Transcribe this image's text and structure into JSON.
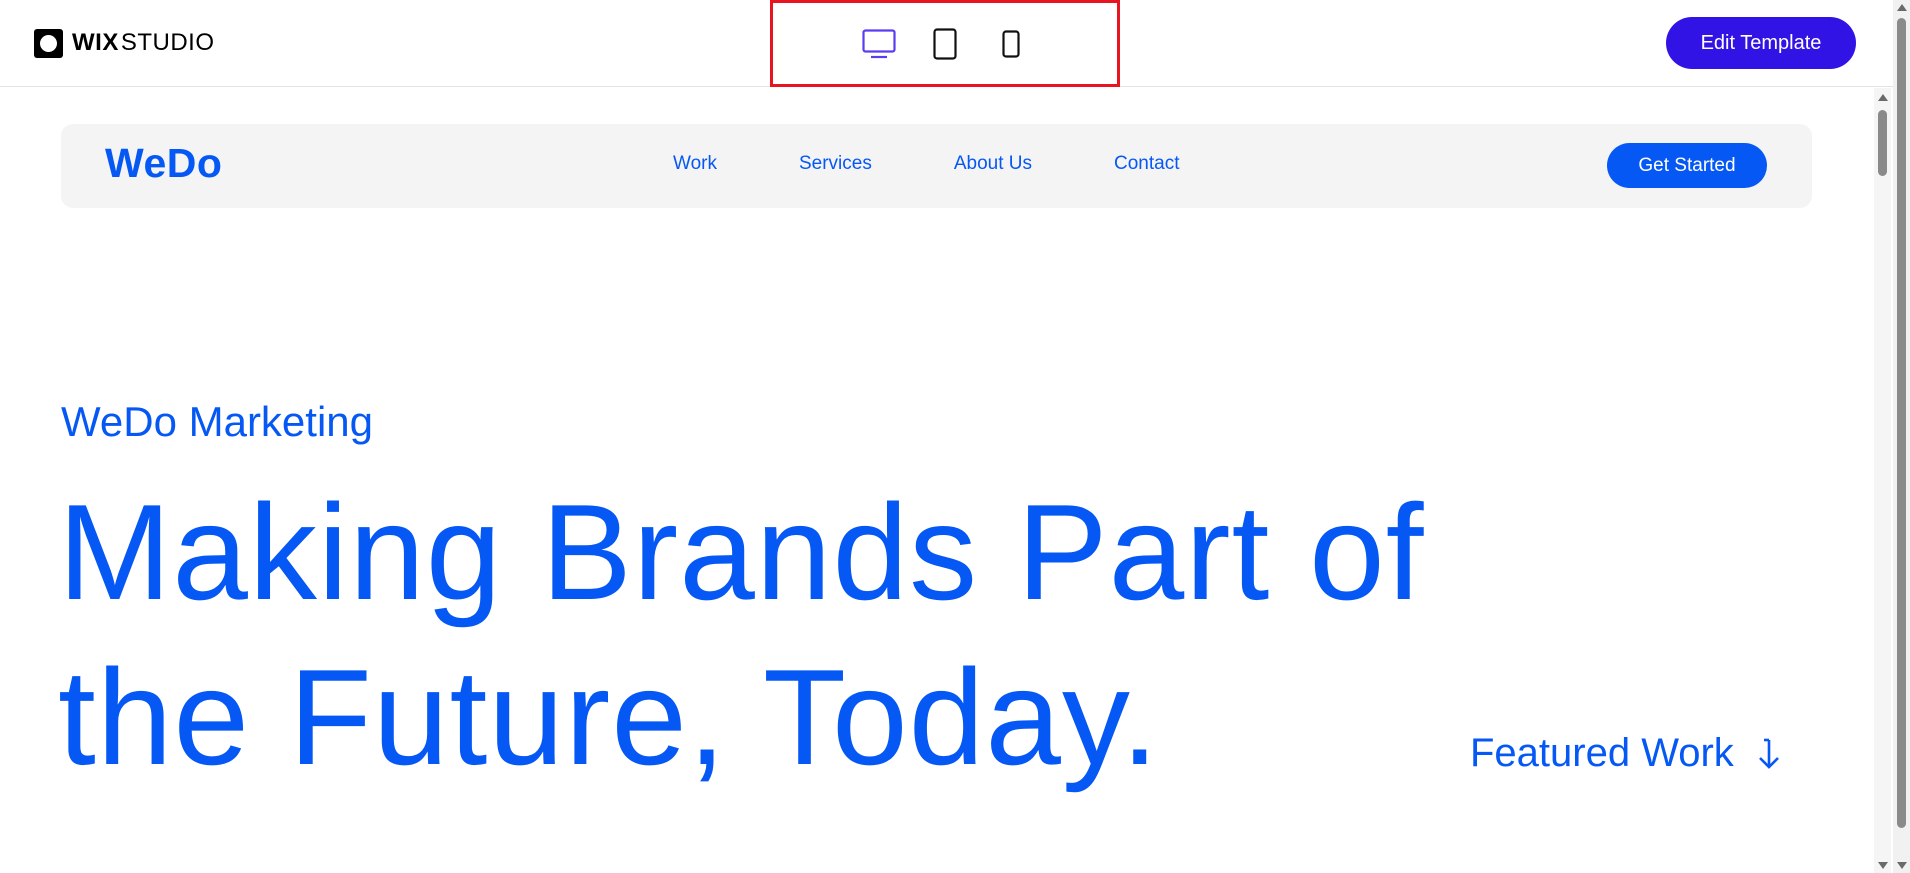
{
  "topbar": {
    "logo_bold": "WIX",
    "logo_light": "STUDIO",
    "devices": [
      {
        "name": "desktop",
        "icon": "desktop-icon",
        "active": true
      },
      {
        "name": "tablet",
        "icon": "tablet-icon",
        "active": false
      },
      {
        "name": "mobile",
        "icon": "mobile-icon",
        "active": false
      }
    ],
    "edit_button_label": "Edit Template"
  },
  "site": {
    "logo": "WeDo",
    "nav": [
      "Work",
      "Services",
      "About Us",
      "Contact"
    ],
    "cta_label": "Get Started",
    "hero": {
      "subtitle": "WeDo Marketing",
      "title_line1": "Making Brands Part of",
      "title_line2": "the Future, Today."
    },
    "featured_label": "Featured Work",
    "featured_icon": "arrow-down-icon"
  },
  "colors": {
    "brand_blue": "#0658f5",
    "edit_button": "#3213e6",
    "active_device": "#5b3cf0",
    "highlight_border": "#e8141f"
  }
}
